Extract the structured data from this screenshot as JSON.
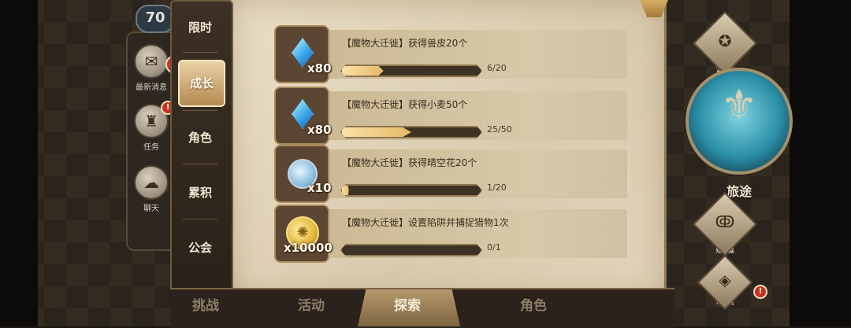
{
  "hud": {
    "level": "70",
    "news_label": "最新消息",
    "tasks_label": "任务",
    "chat_label": "聊天"
  },
  "category_tabs": [
    "限时",
    "成长",
    "角色",
    "累积",
    "公会"
  ],
  "active_tab": "成长",
  "tasks": [
    {
      "title": "【魔物大迁徙】获得兽皮20个",
      "reward_qty": "x80",
      "reward_icon": "blue-crystal-icon",
      "progress_text": "6/20",
      "progress": 0.3
    },
    {
      "title": "【魔物大迁徙】获得小麦50个",
      "reward_qty": "x80",
      "reward_icon": "blue-crystal-icon",
      "progress_text": "25/50",
      "progress": 0.5
    },
    {
      "title": "【魔物大迁徙】获得晴空花20个",
      "reward_qty": "x10",
      "reward_icon": "potion-flask-icon",
      "progress_text": "1/20",
      "progress": 0.05
    },
    {
      "title": "【魔物大迁徙】设置陷阱并捕捉猎物1次",
      "reward_qty": "x10000",
      "reward_icon": "gold-coin-icon",
      "progress_text": "0/1",
      "progress": 0
    }
  ],
  "bottom_nav": {
    "challenge": "挑战",
    "activity": "活动",
    "explore": "探索",
    "character": "角色"
  },
  "right_hud": {
    "guild_label": "公会",
    "journey_label": "旅途",
    "soul_label": "赋魂",
    "market_label": "市集"
  },
  "colors": {
    "parchment": "#d9cbae",
    "progress_fill": "#e6b866",
    "alert": "#c8321e"
  }
}
